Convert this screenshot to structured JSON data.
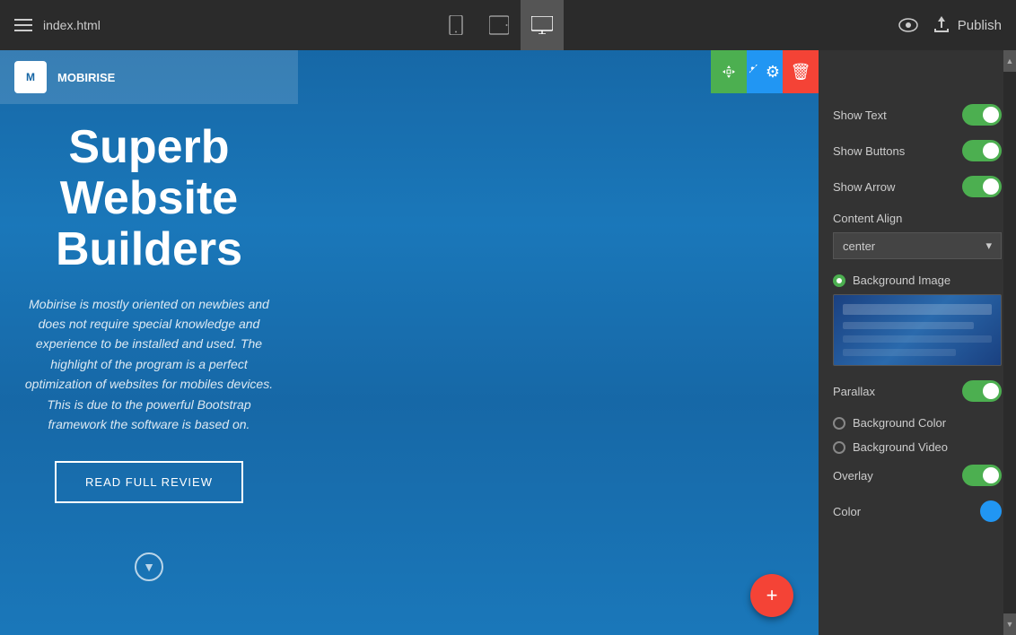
{
  "header": {
    "title": "index.html",
    "publish_label": "Publish"
  },
  "devices": [
    {
      "id": "mobile",
      "icon": "📱"
    },
    {
      "id": "tablet",
      "icon": "📋"
    },
    {
      "id": "desktop",
      "icon": "🖥️",
      "active": true
    }
  ],
  "preview": {
    "hero_title": "Superb Website Builders",
    "hero_subtitle": "Mobirise is mostly oriented on newbies and does not require special knowledge and experience to be installed and used. The highlight of the program is a perfect optimization of websites for mobiles devices. This is due to the powerful Bootstrap framework the software is based on.",
    "hero_btn": "READ FULL REVIEW",
    "nav_logo": "M",
    "nav_brand": "MOBIRISE"
  },
  "settings": {
    "show_text_label": "Show Text",
    "show_buttons_label": "Show Buttons",
    "show_arrow_label": "Show Arrow",
    "content_align_label": "Content Align",
    "content_align_value": "center",
    "background_image_label": "Background Image",
    "parallax_label": "Parallax",
    "background_color_label": "Background Color",
    "background_video_label": "Background Video",
    "overlay_label": "Overlay",
    "color_label": "Color"
  },
  "toolbar": {
    "move_icon": "↕",
    "settings_icon": "⚙",
    "delete_icon": "🗑"
  },
  "fab": {
    "icon": "+"
  }
}
